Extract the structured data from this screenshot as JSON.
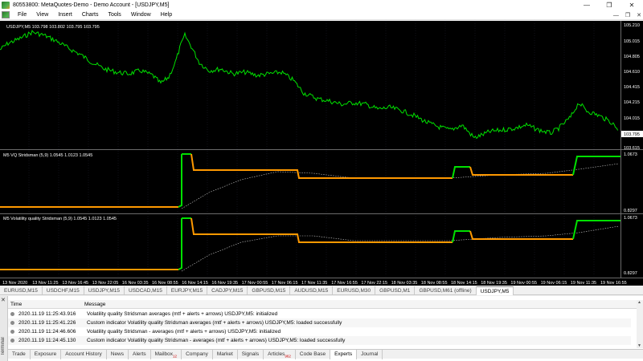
{
  "window": {
    "title": "80553800: MetaQuotes-Demo - Demo Account - [USDJPY,M5]"
  },
  "menu": [
    "File",
    "View",
    "Insert",
    "Charts",
    "Tools",
    "Window",
    "Help"
  ],
  "chart": {
    "main_label": "USDJPY,M5  103.798 103.802 103.795 103.795",
    "price_levels": [
      "105.210",
      "105.015",
      "104.805",
      "104.610",
      "104.415",
      "104.215",
      "104.015",
      "103.795",
      "103.615"
    ],
    "current_price": "103.795",
    "pane1_label": "M5 VQ Stridsman (5,9) 1.0545 1.0123 1.0545",
    "pane1_levels": [
      "1.0673",
      "0.8297"
    ],
    "pane2_label": "M5 Volatility quality Stridsman (5,9) 1.0545 1.0123 1.0545",
    "pane2_levels": [
      "1.0673",
      "0.8297"
    ],
    "time_labels": [
      "13 Nov 2020",
      "13 Nov 11:25",
      "13 Nov 16:45",
      "13 Nov 22:05",
      "16 Nov 03:35",
      "16 Nov 08:55",
      "16 Nov 14:15",
      "16 Nov 19:35",
      "17 Nov 00:55",
      "17 Nov 06:15",
      "17 Nov 11:35",
      "17 Nov 16:55",
      "17 Nov 22:15",
      "18 Nov 03:35",
      "18 Nov 08:55",
      "18 Nov 14:15",
      "18 Nov 19:35",
      "19 Nov 00:55",
      "19 Nov 06:15",
      "19 Nov 11:35",
      "19 Nov 16:55"
    ],
    "colors": {
      "price": "#00e000",
      "grid": "#1c1c1c",
      "indicator_up": "#00e000",
      "indicator_down": "#ff9900",
      "signal": "#cccccc",
      "background": "#000000"
    }
  },
  "chart_tabs": [
    "EURUSD,M15",
    "USDCHF,M15",
    "USDJPY,M15",
    "USDCAD,M15",
    "EURJPY,M15",
    "CADJPY,M15",
    "GBPUSD,M15",
    "AUDUSD,M15",
    "EURUSD,M30",
    "GBPUSD,M1",
    "GBPUSD,M61 (offline)",
    "USDJPY,M5"
  ],
  "terminal": {
    "side_label": "Terminal",
    "columns": {
      "time": "Time",
      "message": "Message"
    },
    "rows": [
      {
        "time": "2020.11.19 11:25:43.916",
        "message": "Volatility quality Stridsman  averages (mtf + alerts + arrows) USDJPY,M5: initialized"
      },
      {
        "time": "2020.11.19 11:25:41.226",
        "message": "Custom indicator Volatility quality Stridsman  averages (mtf + alerts + arrows) USDJPY,M5: loaded successfully"
      },
      {
        "time": "2020.11.19 11:24:46.606",
        "message": "Volatility quality Stridsman  - averages (mtf + alerts + arrows) USDJPY,M5: initialized"
      },
      {
        "time": "2020.11.19 11:24:45.130",
        "message": "Custom indicator Volatility quality Stridsman  - averages (mtf + alerts + arrows) USDJPY,M5: loaded successfully"
      }
    ],
    "tabs": [
      {
        "label": "Trade",
        "badge": ""
      },
      {
        "label": "Exposure",
        "badge": ""
      },
      {
        "label": "Account History",
        "badge": ""
      },
      {
        "label": "News",
        "badge": ""
      },
      {
        "label": "Alerts",
        "badge": ""
      },
      {
        "label": "Mailbox",
        "badge": "12"
      },
      {
        "label": "Company",
        "badge": ""
      },
      {
        "label": "Market",
        "badge": ""
      },
      {
        "label": "Signals",
        "badge": ""
      },
      {
        "label": "Articles",
        "badge": "962"
      },
      {
        "label": "Code Base",
        "badge": ""
      },
      {
        "label": "Experts",
        "badge": ""
      },
      {
        "label": "Journal",
        "badge": ""
      }
    ]
  }
}
